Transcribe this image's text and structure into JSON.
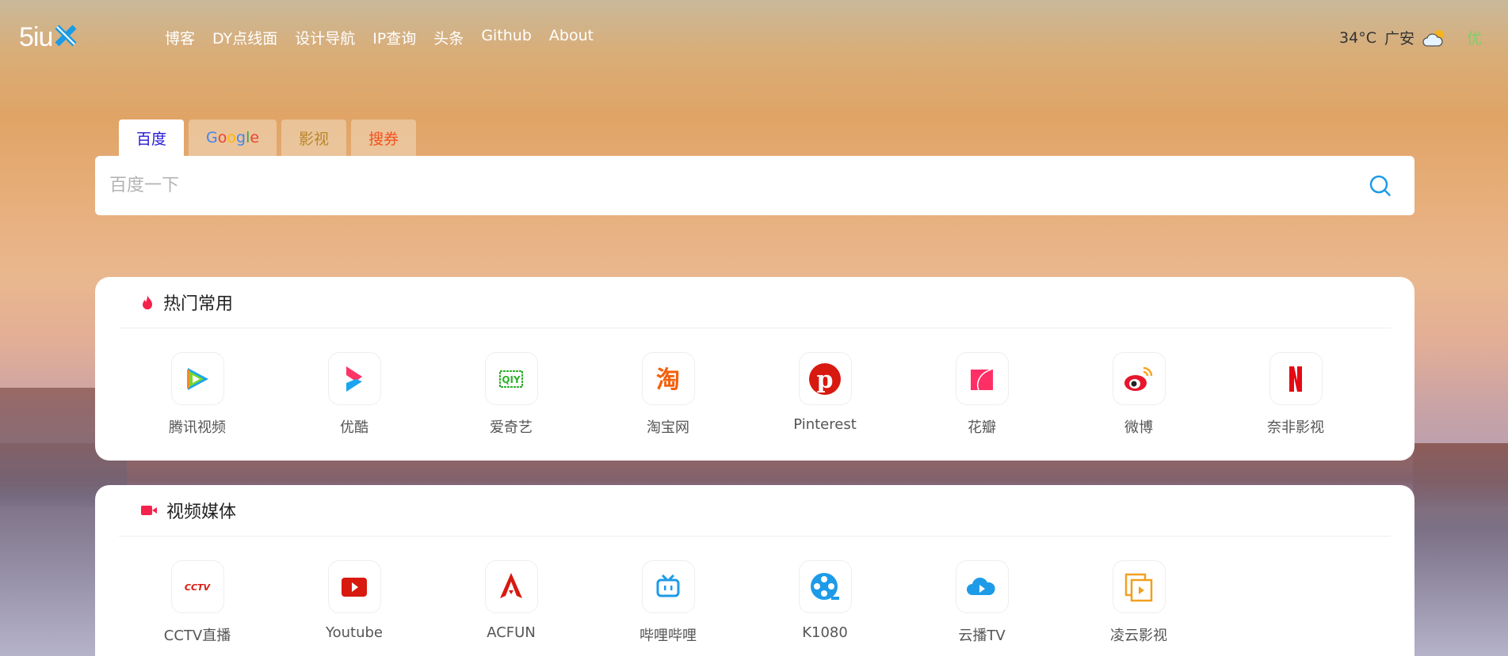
{
  "header": {
    "logo": "5iu",
    "nav": [
      "博客",
      "DY点线面",
      "设计导航",
      "IP查询",
      "头条",
      "Github",
      "About"
    ],
    "weather": {
      "temp": "34°C",
      "city": "广安",
      "icon": "partly-cloudy-icon",
      "aqi": "优"
    }
  },
  "search": {
    "tabs": [
      {
        "label": "百度",
        "color": "#2418d6"
      },
      {
        "label": "Google",
        "color": "#4285f4"
      },
      {
        "label": "影视",
        "color": "#b8862a"
      },
      {
        "label": "搜券",
        "color": "#f4511e"
      }
    ],
    "placeholder": "百度一下",
    "value": ""
  },
  "sections": [
    {
      "title": "热门常用",
      "icon": "fire-icon",
      "items": [
        {
          "label": "腾讯视频",
          "icon": "tencent-video-icon"
        },
        {
          "label": "优酷",
          "icon": "youku-icon"
        },
        {
          "label": "爱奇艺",
          "icon": "iqiyi-icon"
        },
        {
          "label": "淘宝网",
          "icon": "taobao-icon"
        },
        {
          "label": "Pinterest",
          "icon": "pinterest-icon"
        },
        {
          "label": "花瓣",
          "icon": "huaban-icon"
        },
        {
          "label": "微博",
          "icon": "weibo-icon"
        },
        {
          "label": "奈非影视",
          "icon": "netflix-icon"
        }
      ]
    },
    {
      "title": "视频媒体",
      "icon": "video-camera-icon",
      "items": [
        {
          "label": "CCTV直播",
          "icon": "cctv-icon"
        },
        {
          "label": "Youtube",
          "icon": "youtube-icon"
        },
        {
          "label": "ACFUN",
          "icon": "acfun-icon"
        },
        {
          "label": "哔哩哔哩",
          "icon": "bilibili-icon"
        },
        {
          "label": "K1080",
          "icon": "film-reel-icon"
        },
        {
          "label": "云播TV",
          "icon": "cloud-play-icon"
        },
        {
          "label": "凌云影视",
          "icon": "film-strip-icon"
        }
      ]
    }
  ]
}
